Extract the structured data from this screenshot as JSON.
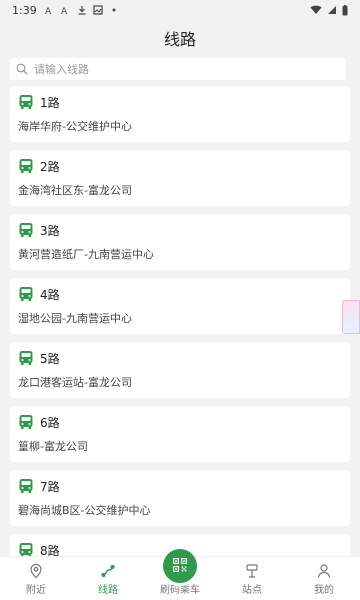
{
  "status": {
    "time": "1:39"
  },
  "header": {
    "title": "线路"
  },
  "search": {
    "placeholder": "请输入线路"
  },
  "routes": [
    {
      "name": "1路",
      "dest": "海岸华府-公交维护中心"
    },
    {
      "name": "2路",
      "dest": "金海湾社区东-富龙公司"
    },
    {
      "name": "3路",
      "dest": "黄河营造纸厂-九南营运中心"
    },
    {
      "name": "4路",
      "dest": "湿地公园-九南营运中心"
    },
    {
      "name": "5路",
      "dest": "龙口港客运站-富龙公司"
    },
    {
      "name": "6路",
      "dest": "篁柳-富龙公司"
    },
    {
      "name": "7路",
      "dest": "碧海尚城B区-公交维护中心"
    },
    {
      "name": "8路",
      "dest": ""
    }
  ],
  "tabs": {
    "nearby": "附近",
    "routes": "线路",
    "scan": "刷码乘车",
    "stops": "站点",
    "mine": "我的"
  },
  "colors": {
    "accent": "#2f9a4a"
  }
}
